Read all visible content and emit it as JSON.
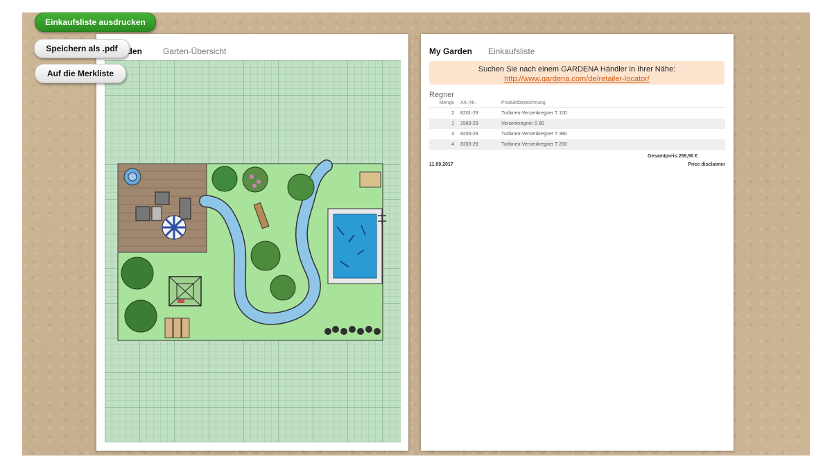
{
  "toolbar": {
    "print_label": "Einkaufsliste ausdrucken",
    "pdf_label": "Speichern als .pdf",
    "watchlist_label": "Auf die Merkliste"
  },
  "left_page": {
    "tabs": [
      {
        "label": "My Garden",
        "active": true
      },
      {
        "label": "Garten-Übersicht",
        "active": false
      }
    ]
  },
  "right_page": {
    "tabs": [
      {
        "label": "My Garden",
        "active": true
      },
      {
        "label": "Einkaufsliste",
        "active": false
      }
    ],
    "notice": {
      "text": "Suchen Sie nach einem GARDENA Händler in Ihrer Nähe:",
      "link": "http://www.gardena.com/de/retailer-locator/"
    },
    "section": "Regner",
    "columns": {
      "qty": "Menge",
      "art": "Art.-Nr.",
      "name": "Produktbezeichnung"
    },
    "rows": [
      {
        "qty": "2",
        "art": "8201-29",
        "name": "Turbinen-Versenkregner T 100"
      },
      {
        "qty": "1",
        "art": "1569-29",
        "name": "Versenkregner S 80"
      },
      {
        "qty": "3",
        "art": "8205-29",
        "name": "Turbinen-Versenkregner T 380"
      },
      {
        "qty": "4",
        "art": "8203-29",
        "name": "Turbinen-Versenkregner T 200"
      }
    ],
    "total": "Gesamtpreis:259,90 €",
    "date": "11.09.2017",
    "disclaimer": "Price disclaimer"
  },
  "colors": {
    "button_green": "#3aa52d",
    "lawn": "#a8e29b",
    "terrace": "#a08770",
    "water": "#8fc6e8",
    "pool": "#2b9bd6",
    "notice_bg": "#fde4cf",
    "link": "#d35a12"
  }
}
